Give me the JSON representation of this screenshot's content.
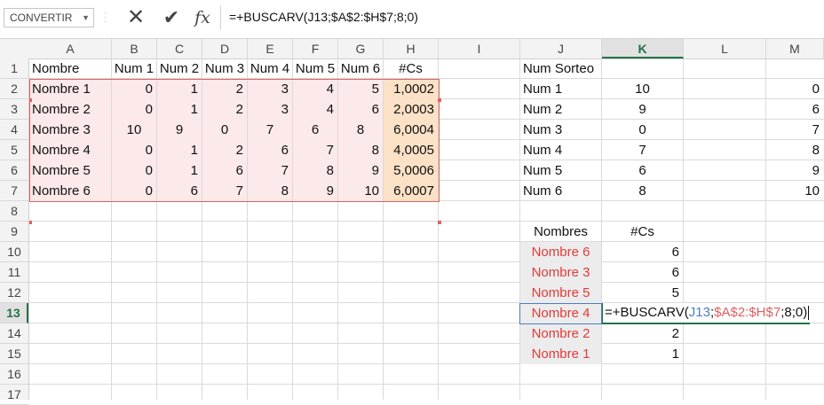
{
  "name_box": {
    "value": "CONVERTIR"
  },
  "formula_bar": {
    "cancel_icon": "cross-icon",
    "enter_icon": "check-icon",
    "fx_label": "fx",
    "formula": "=+BUSCARV(J13;$A$2:$H$7;8;0)"
  },
  "columns": [
    "A",
    "B",
    "C",
    "D",
    "E",
    "F",
    "G",
    "H",
    "I",
    "J",
    "K",
    "L",
    "M"
  ],
  "rows": [
    "1",
    "2",
    "3",
    "4",
    "5",
    "6",
    "7",
    "8",
    "9",
    "10",
    "11",
    "12",
    "13",
    "14",
    "15",
    "16",
    "17"
  ],
  "selected": {
    "column": "K",
    "row": "13"
  },
  "table1": {
    "headers": [
      "Nombre",
      "Num 1",
      "Num 2",
      "Num 3",
      "Num 4",
      "Num 5",
      "Num 6",
      "#Cs"
    ],
    "rows": [
      [
        "Nombre 1",
        "0",
        "1",
        "2",
        "3",
        "4",
        "5",
        "1,0002"
      ],
      [
        "Nombre 2",
        "0",
        "1",
        "2",
        "3",
        "4",
        "6",
        "2,0003"
      ],
      [
        "Nombre 3",
        "10",
        "9",
        "0",
        "7",
        "6",
        "8",
        "6,0004"
      ],
      [
        "Nombre 4",
        "0",
        "1",
        "2",
        "6",
        "7",
        "8",
        "4,0005"
      ],
      [
        "Nombre 5",
        "0",
        "1",
        "6",
        "7",
        "8",
        "9",
        "5,0006"
      ],
      [
        "Nombre 6",
        "0",
        "6",
        "7",
        "8",
        "9",
        "10",
        "6,0007"
      ]
    ]
  },
  "sorteo": {
    "header": "Num Sorteo",
    "rows": [
      [
        "Num 1",
        "10",
        "0"
      ],
      [
        "Num 2",
        "9",
        "6"
      ],
      [
        "Num 3",
        "0",
        "7"
      ],
      [
        "Num 4",
        "7",
        "8"
      ],
      [
        "Num 5",
        "6",
        "9"
      ],
      [
        "Num 6",
        "8",
        "10"
      ]
    ]
  },
  "ranking": {
    "headers": [
      "Nombres",
      "#Cs"
    ],
    "rows": [
      [
        "Nombre 6",
        "6"
      ],
      [
        "Nombre 3",
        "6"
      ],
      [
        "Nombre 5",
        "5"
      ],
      [
        "Nombre 4",
        ""
      ],
      [
        "Nombre 2",
        "2"
      ],
      [
        "Nombre 1",
        "1"
      ]
    ]
  },
  "edit_cell": {
    "prefix": "=+BUSCARV(",
    "ref1": "J13",
    "sep1": ";",
    "ref2": "$A$2:$H$7",
    "suffix": ";8;0)"
  }
}
